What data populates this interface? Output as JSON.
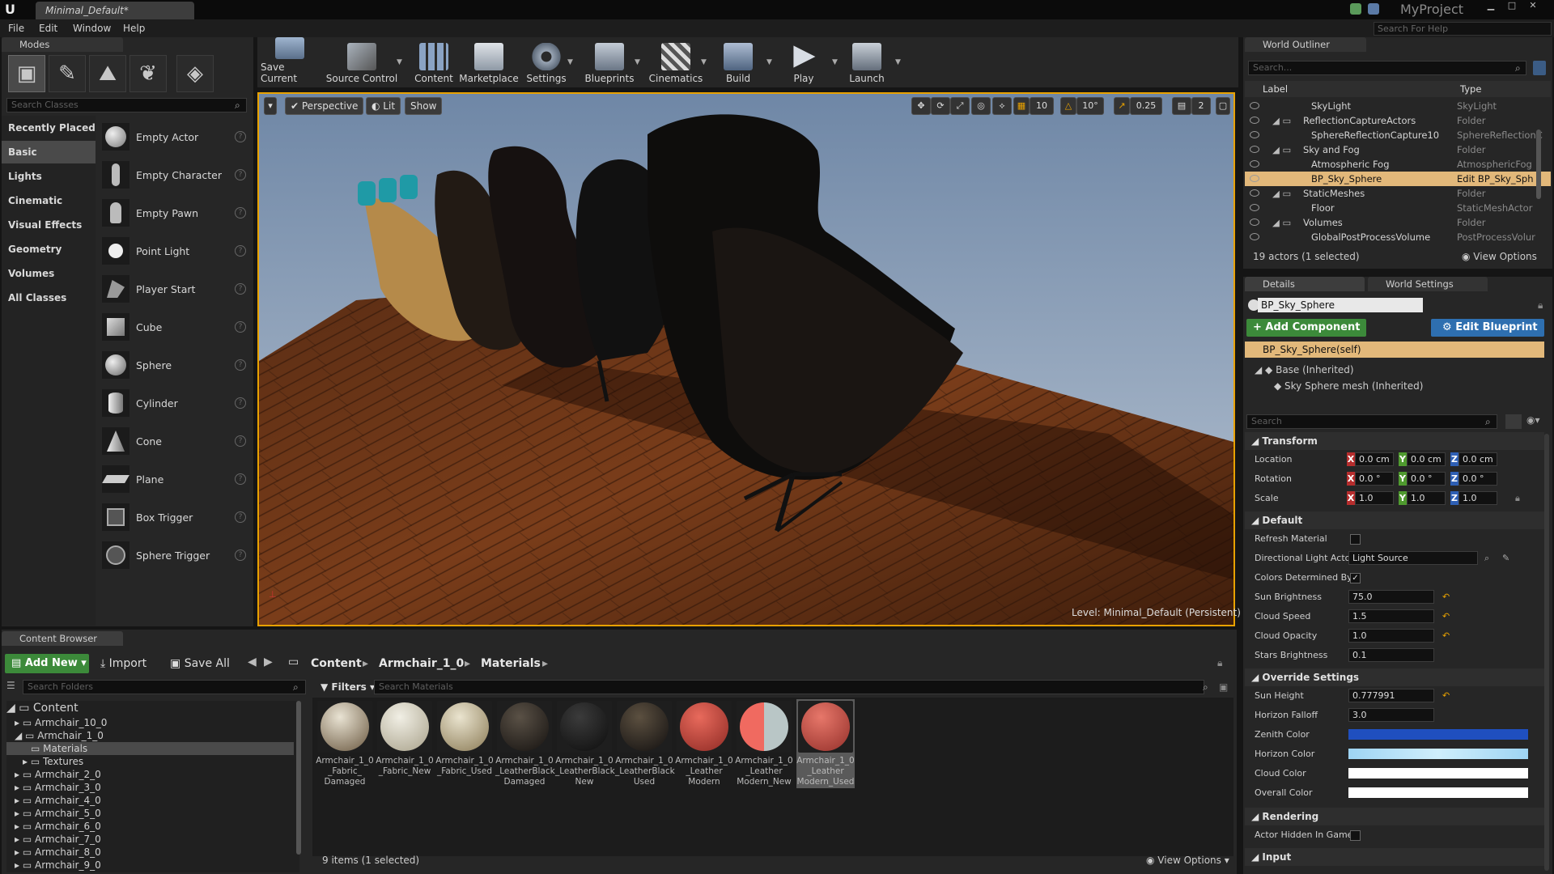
{
  "window": {
    "tab": "Minimal_Default*",
    "project": "MyProject",
    "help_search": "Search For Help"
  },
  "menu": [
    "File",
    "Edit",
    "Window",
    "Help"
  ],
  "modes": {
    "tab": "Modes",
    "search": "Search Classes",
    "categories": [
      "Recently Placed",
      "Basic",
      "Lights",
      "Cinematic",
      "Visual Effects",
      "Geometry",
      "Volumes",
      "All Classes"
    ],
    "items": [
      "Empty Actor",
      "Empty Character",
      "Empty Pawn",
      "Point Light",
      "Player Start",
      "Cube",
      "Sphere",
      "Cylinder",
      "Cone",
      "Plane",
      "Box Trigger",
      "Sphere Trigger"
    ]
  },
  "toolbar": [
    "Save Current",
    "Source Control",
    "Content",
    "Marketplace",
    "Settings",
    "Blueprints",
    "Cinematics",
    "Build",
    "Play",
    "Launch"
  ],
  "viewport": {
    "perspective": "Perspective",
    "lit": "Lit",
    "show": "Show",
    "grid": "10",
    "angle": "10°",
    "scale": "0.25",
    "speed": "2",
    "level": "Level:  Minimal_Default (Persistent)"
  },
  "outliner": {
    "tab": "World Outliner",
    "search": "Search...",
    "col_label": "Label",
    "col_type": "Type",
    "rows": [
      {
        "label": "SkyLight",
        "type": "SkyLight"
      },
      {
        "label": "ReflectionCaptureActors",
        "type": "Folder"
      },
      {
        "label": "SphereReflectionCapture10",
        "type": "SphereReflectionC"
      },
      {
        "label": "Sky and Fog",
        "type": "Folder"
      },
      {
        "label": "Atmospheric Fog",
        "type": "AtmosphericFog"
      },
      {
        "label": "BP_Sky_Sphere",
        "type": "Edit BP_Sky_Sph"
      },
      {
        "label": "StaticMeshes",
        "type": "Folder"
      },
      {
        "label": "Floor",
        "type": "StaticMeshActor"
      },
      {
        "label": "Volumes",
        "type": "Folder"
      },
      {
        "label": "GlobalPostProcessVolume",
        "type": "PostProcessVolur"
      }
    ],
    "status": "19 actors (1 selected)",
    "view_options": "View Options"
  },
  "details": {
    "tab": "Details",
    "tab2": "World Settings",
    "name": "BP_Sky_Sphere",
    "add_component": "Add Component",
    "edit_blueprint": "Edit Blueprint",
    "self": "BP_Sky_Sphere(self)",
    "base": "Base (Inherited)",
    "mesh": "Sky Sphere mesh (Inherited)",
    "search": "Search",
    "transform": "Transform",
    "location": "Location",
    "rotation": "Rotation",
    "scale": "Scale",
    "loc": [
      "0.0 cm",
      "0.0 cm",
      "0.0 cm"
    ],
    "rot": [
      "0.0 °",
      "0.0 °",
      "0.0 °"
    ],
    "scl": [
      "1.0",
      "1.0",
      "1.0"
    ],
    "default": "Default",
    "refresh": "Refresh Material",
    "dir_light": "Directional Light Actor",
    "dir_light_val": "Light Source",
    "colors_det": "Colors Determined By",
    "sun_brightness": "Sun Brightness",
    "sun_brightness_val": "75.0",
    "cloud_speed": "Cloud Speed",
    "cloud_speed_val": "1.5",
    "cloud_opacity": "Cloud Opacity",
    "cloud_opacity_val": "1.0",
    "stars": "Stars Brightness",
    "stars_val": "0.1",
    "override": "Override Settings",
    "sun_height": "Sun Height",
    "sun_height_val": "0.777991",
    "horizon_falloff": "Horizon Falloff",
    "horizon_falloff_val": "3.0",
    "zenith": "Zenith Color",
    "horizon": "Horizon Color",
    "cloud_color": "Cloud Color",
    "overall": "Overall Color",
    "rendering": "Rendering",
    "hidden": "Actor Hidden In Game",
    "input": "Input",
    "colors": {
      "zenith": "#1f4fbf",
      "horizon": "#b9e1f7",
      "cloud": "#ffffff",
      "overall": "#ffffff"
    }
  },
  "content": {
    "tab": "Content Browser",
    "add_new": "Add New",
    "import": "Import",
    "save_all": "Save All",
    "path": [
      "Content",
      "Armchair_1_0",
      "Materials"
    ],
    "search_folders": "Search Folders",
    "filters": "Filters",
    "search_materials": "Search Materials",
    "tree": [
      "Content",
      "Armchair_10_0",
      "Armchair_1_0",
      "Materials",
      "Textures",
      "Armchair_2_0",
      "Armchair_3_0",
      "Armchair_4_0",
      "Armchair_5_0",
      "Armchair_6_0",
      "Armchair_7_0",
      "Armchair_8_0",
      "Armchair_9_0"
    ],
    "assets": [
      {
        "l1": "Armchair_1_0",
        "l2": "_Fabric_",
        "l3": "Damaged",
        "c1": "#e9e3d3",
        "c2": "#6a5840"
      },
      {
        "l1": "Armchair_1_0",
        "l2": "_Fabric_New",
        "l3": "",
        "c1": "#f1efe5",
        "c2": "#a8a18a"
      },
      {
        "l1": "Armchair_1_0",
        "l2": "_Fabric_Used",
        "l3": "",
        "c1": "#eae4cf",
        "c2": "#8a7a55"
      },
      {
        "l1": "Armchair_1_0",
        "l2": "_LeatherBlack",
        "l3": "Damaged",
        "c1": "#5a5146",
        "c2": "#151210"
      },
      {
        "l1": "Armchair_1_0",
        "l2": "_LeatherBlack",
        "l3": "New",
        "c1": "#3b3b3b",
        "c2": "#0d0d0d"
      },
      {
        "l1": "Armchair_1_0",
        "l2": "_LeatherBlack",
        "l3": "Used",
        "c1": "#5c5040",
        "c2": "#121010"
      },
      {
        "l1": "Armchair_1_0",
        "l2": "_Leather",
        "l3": "Modern",
        "c1": "#e86a5c",
        "c2": "#8e2a24"
      },
      {
        "l1": "Armchair_1_0",
        "l2": "_Leather",
        "l3": "Modern_New",
        "c1": "#f06a60",
        "c2": "#b9c6c6"
      },
      {
        "l1": "Armchair_1_0",
        "l2": "_Leather",
        "l3": "Modern_Used",
        "c1": "#e7776a",
        "c2": "#94302a"
      }
    ],
    "status": "9 items (1 selected)",
    "view_options": "View Options"
  }
}
